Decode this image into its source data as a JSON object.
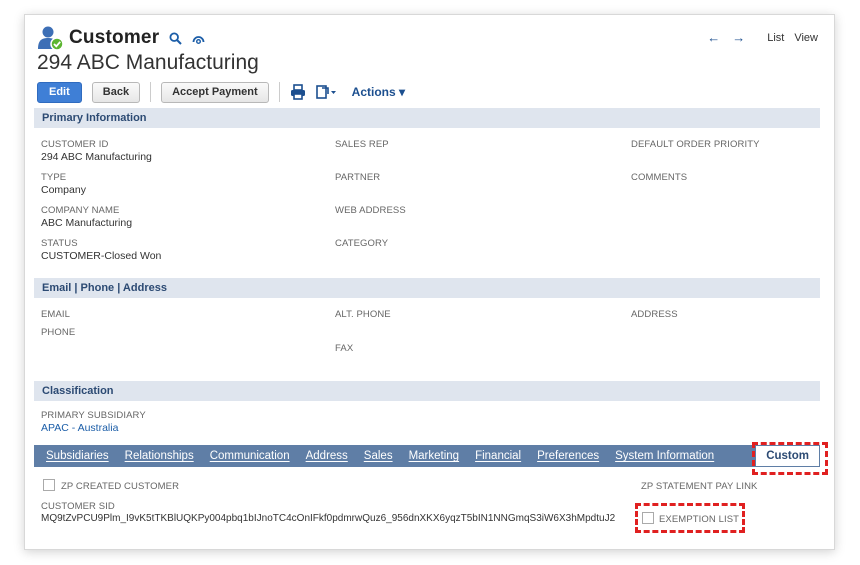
{
  "header": {
    "record_type": "Customer",
    "record_name": "294 ABC Manufacturing",
    "nav_list": "List",
    "nav_view": "View",
    "icons": [
      "customer-icon",
      "search-icon",
      "link-icon",
      "back-arrow-icon",
      "forward-arrow-icon"
    ]
  },
  "toolbar": {
    "edit": "Edit",
    "back": "Back",
    "accept_payment": "Accept Payment",
    "actions": "Actions",
    "actions_caret": "▾",
    "icons": [
      "print-icon",
      "more-actions-icon"
    ]
  },
  "primary_info": {
    "title": "Primary Information",
    "customer_id_label": "CUSTOMER ID",
    "customer_id_value": "294 ABC Manufacturing",
    "type_label": "TYPE",
    "type_value": "Company",
    "company_name_label": "COMPANY NAME",
    "company_name_value": "ABC Manufacturing",
    "status_label": "STATUS",
    "status_value": "CUSTOMER-Closed Won",
    "sales_rep_label": "SALES REP",
    "partner_label": "PARTNER",
    "web_address_label": "WEB ADDRESS",
    "category_label": "CATEGORY",
    "default_order_priority_label": "DEFAULT ORDER PRIORITY",
    "comments_label": "COMMENTS"
  },
  "contact": {
    "title": "Email | Phone | Address",
    "email_label": "EMAIL",
    "phone_label": "PHONE",
    "alt_phone_label": "ALT. PHONE",
    "fax_label": "FAX",
    "address_label": "ADDRESS"
  },
  "classification": {
    "title": "Classification",
    "primary_subsidiary_label": "PRIMARY SUBSIDIARY",
    "primary_subsidiary_value": "APAC - Australia"
  },
  "tabs": [
    {
      "label": "Subsidiaries"
    },
    {
      "label": "Relationships"
    },
    {
      "label": "Communication"
    },
    {
      "label": "Address"
    },
    {
      "label": "Sales"
    },
    {
      "label": "Marketing"
    },
    {
      "label": "Financial"
    },
    {
      "label": "Preferences"
    },
    {
      "label": "System Information"
    },
    {
      "label": "Custom"
    }
  ],
  "custom": {
    "zp_created_customer_label": "ZP CREATED CUSTOMER",
    "zp_statement_pay_link_label": "ZP STATEMENT PAY LINK",
    "customer_sid_label": "CUSTOMER SID",
    "customer_sid_value": "MQ9tZvPCU9Plm_I9vK5tTKBlUQKPy004pbq1bIJnoTC4cOnIFkf0pdmrwQuz6_956dnXKX6yqzT5bIN1NNGmqS3iW6X3hMpdtuJ2",
    "exemption_list_label": "EXEMPTION LIST"
  },
  "colors": {
    "accent_blue": "#3f7fd6",
    "tab_bar": "#5f7ea6",
    "section_bar": "#dfe5ee",
    "highlight_dash": "#e02020"
  }
}
